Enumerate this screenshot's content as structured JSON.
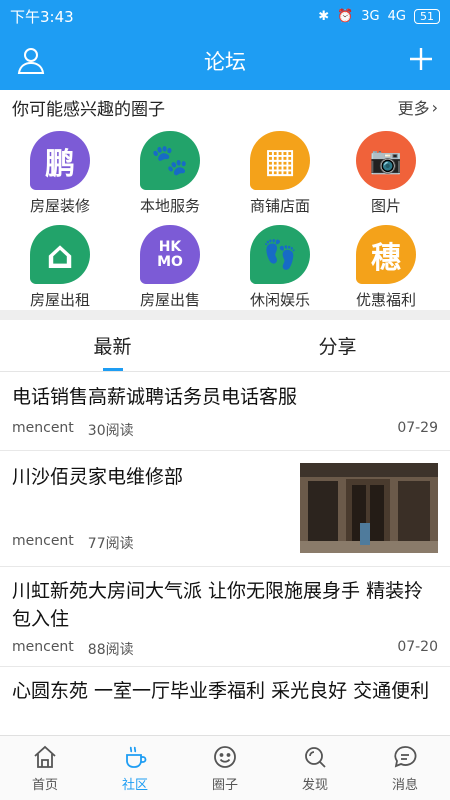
{
  "status": {
    "time": "下午3:43",
    "network": "3G",
    "network2": "4G",
    "battery": "51"
  },
  "app": {
    "title": "论坛"
  },
  "circles": {
    "heading": "你可能感兴趣的圈子",
    "more": "更多",
    "items": [
      {
        "label": "房屋装修",
        "glyph": "鹏",
        "color": "#7c5bd6",
        "icon": "peng-icon"
      },
      {
        "label": "本地服务",
        "glyph": "🐾",
        "color": "#22a36a",
        "icon": "paw-icon"
      },
      {
        "label": "商铺店面",
        "glyph": "▦",
        "color": "#f4a21a",
        "icon": "shop-icon"
      },
      {
        "label": "图片",
        "glyph": "📷",
        "color": "#f0623a",
        "icon": "camera-icon"
      },
      {
        "label": "房屋出租",
        "glyph": "⌂",
        "color": "#22a36a",
        "icon": "house-heart-icon"
      },
      {
        "label": "房屋出售",
        "glyph": "HKMO",
        "color": "#7c5bd6",
        "icon": "hkmo-icon"
      },
      {
        "label": "休闲娱乐",
        "glyph": "👣",
        "color": "#22a36a",
        "icon": "footprints-icon"
      },
      {
        "label": "优惠福利",
        "glyph": "穗",
        "color": "#f4a21a",
        "icon": "sui-icon"
      }
    ]
  },
  "tabs": [
    {
      "label": "最新"
    },
    {
      "label": "分享"
    }
  ],
  "posts": [
    {
      "title": "电话销售高薪诚聘话务员电话客服",
      "author": "mencent",
      "reads": "30阅读",
      "date": "07-29"
    },
    {
      "title": "川沙佰灵家电维修部",
      "author": "mencent",
      "reads": "77阅读",
      "date": ""
    },
    {
      "title": "川虹新苑大房间大气派 让你无限施展身手 精装拎包入住",
      "author": "mencent",
      "reads": "88阅读",
      "date": "07-20"
    },
    {
      "title": "心圆东苑 一室一厅毕业季福利 采光良好 交通便利",
      "author": "",
      "reads": "",
      "date": ""
    }
  ],
  "bottomnav": [
    {
      "label": "首页",
      "icon": "home-icon"
    },
    {
      "label": "社区",
      "icon": "community-icon"
    },
    {
      "label": "圈子",
      "icon": "circle-smile-icon"
    },
    {
      "label": "发现",
      "icon": "discover-icon"
    },
    {
      "label": "消息",
      "icon": "message-icon"
    }
  ],
  "colors": {
    "accent": "#1e9df3",
    "separator": "#eeeeee"
  }
}
